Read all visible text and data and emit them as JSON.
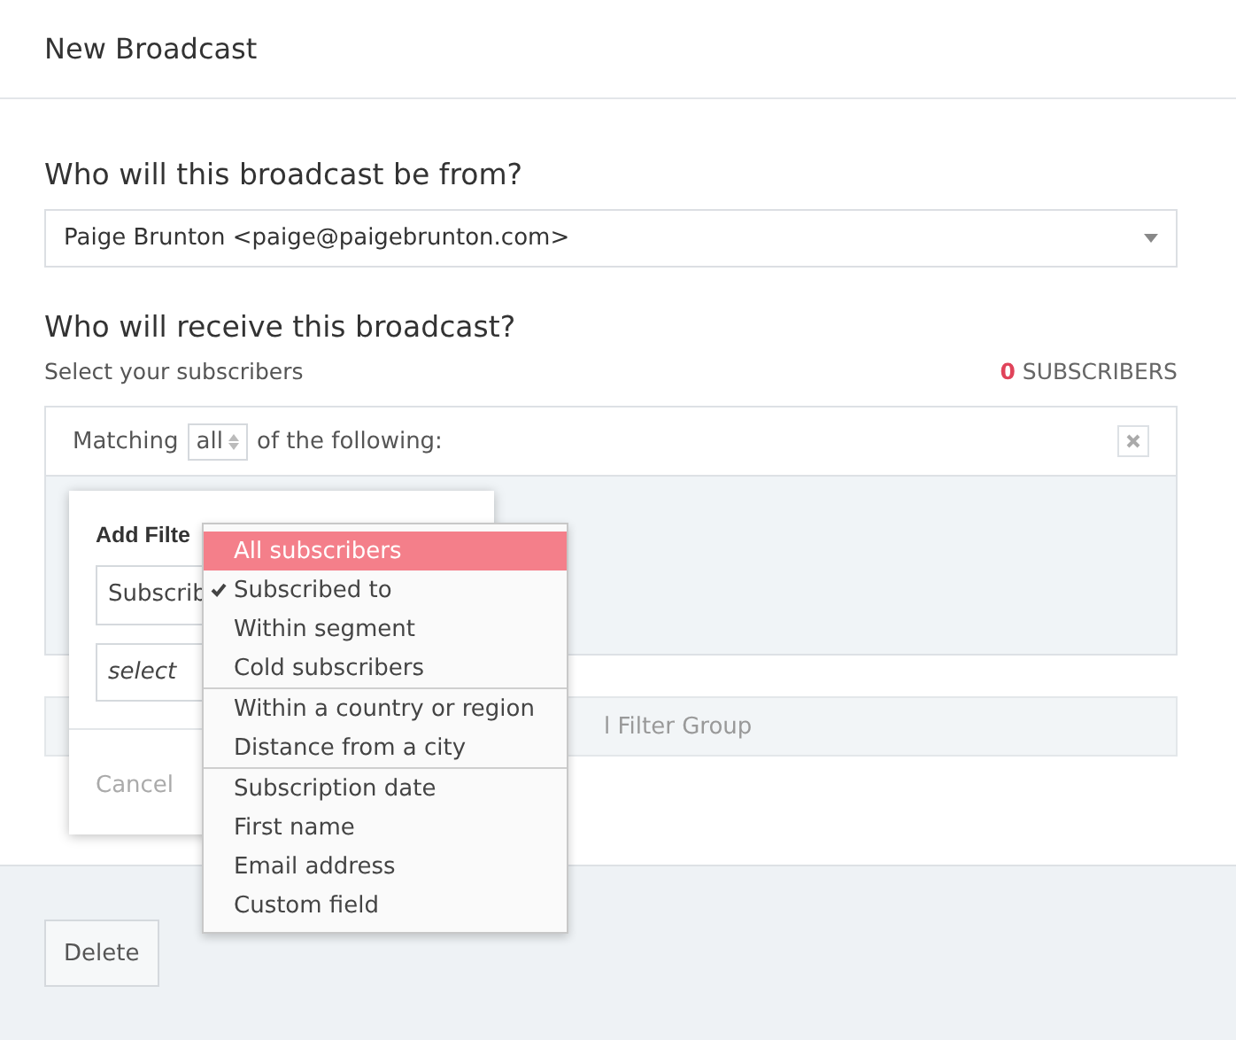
{
  "header": {
    "title": "New Broadcast"
  },
  "from_section": {
    "heading": "Who will this broadcast be from?",
    "sender": "Paige Brunton <paige@paigebrunton.com>"
  },
  "receive_section": {
    "heading": "Who will receive this broadcast?",
    "label": "Select your subscribers",
    "count": "0",
    "count_label": "SUBSCRIBERS"
  },
  "filter_group": {
    "matching_prefix": "Matching",
    "matching_value": "all",
    "matching_suffix": "of the following:"
  },
  "add_filter_group_button": {
    "label": "l Filter Group"
  },
  "filter_popover": {
    "title": "Add Filte",
    "type_select": "Subscrib",
    "value_placeholder": "select",
    "cancel": "Cancel"
  },
  "dropdown": {
    "groups": [
      [
        {
          "label": "All subscribers",
          "highlighted": true,
          "checked": false
        },
        {
          "label": "Subscribed to",
          "highlighted": false,
          "checked": true
        },
        {
          "label": "Within segment",
          "highlighted": false,
          "checked": false
        },
        {
          "label": "Cold subscribers",
          "highlighted": false,
          "checked": false
        }
      ],
      [
        {
          "label": "Within a country or region",
          "highlighted": false,
          "checked": false
        },
        {
          "label": "Distance from a city",
          "highlighted": false,
          "checked": false
        }
      ],
      [
        {
          "label": "Subscription date",
          "highlighted": false,
          "checked": false
        },
        {
          "label": "First name",
          "highlighted": false,
          "checked": false
        },
        {
          "label": "Email address",
          "highlighted": false,
          "checked": false
        },
        {
          "label": "Custom field",
          "highlighted": false,
          "checked": false
        }
      ]
    ]
  },
  "footer": {
    "delete_button": "Delete"
  }
}
